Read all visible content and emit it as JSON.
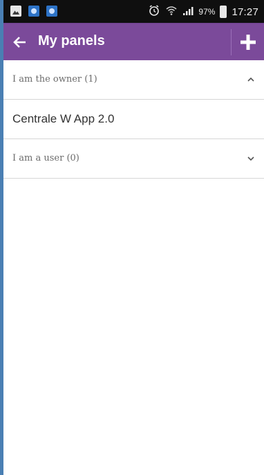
{
  "status_bar": {
    "battery_percent": "97%",
    "time": "17:27",
    "icons": [
      "gallery-icon",
      "app-icon",
      "app-icon",
      "alarm-icon",
      "wifi-icon",
      "signal-icon",
      "battery-icon"
    ]
  },
  "app_bar": {
    "title": "My panels",
    "back_icon": "arrow-left-icon",
    "add_icon": "plus-icon",
    "background": "#7b4a9a"
  },
  "sections": {
    "owner": {
      "label": "I am the owner (1)",
      "expanded": true,
      "items": [
        {
          "label": "Centrale W App 2.0"
        }
      ]
    },
    "user": {
      "label": "I am a user (0)",
      "expanded": false,
      "items": []
    }
  }
}
